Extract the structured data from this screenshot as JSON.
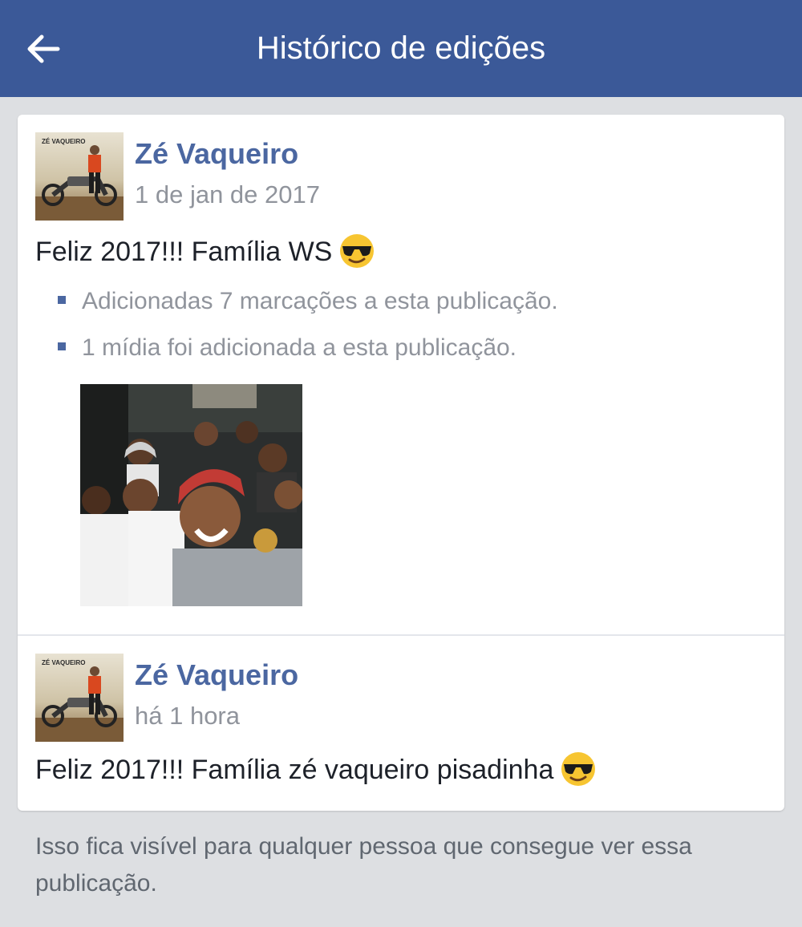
{
  "header": {
    "title": "Histórico de edições",
    "back_icon": "arrow-left-icon",
    "bg_color": "#3b5998"
  },
  "history": [
    {
      "author": "Zé Vaqueiro",
      "time": "1 de jan de 2017",
      "text": "Feliz 2017!!! Família WS",
      "emoji": "smiling-face-with-sunglasses",
      "changes": [
        "Adicionadas 7 marcações a esta publicação.",
        "1 mídia foi adicionada a esta publicação."
      ],
      "avatar_text": "ZÉ VAQUEIRO"
    },
    {
      "author": "Zé Vaqueiro",
      "time": "há 1 hora",
      "text": "Feliz 2017!!! Família zé vaqueiro pisadinha",
      "emoji": "smiling-face-with-sunglasses",
      "avatar_text": "ZÉ VAQUEIRO"
    }
  ],
  "footer": {
    "note": "Isso fica visível para qualquer pessoa que consegue ver essa publicação."
  },
  "colors": {
    "link": "#4b67a1",
    "muted": "#90949c",
    "page_bg": "#dddfe2"
  }
}
